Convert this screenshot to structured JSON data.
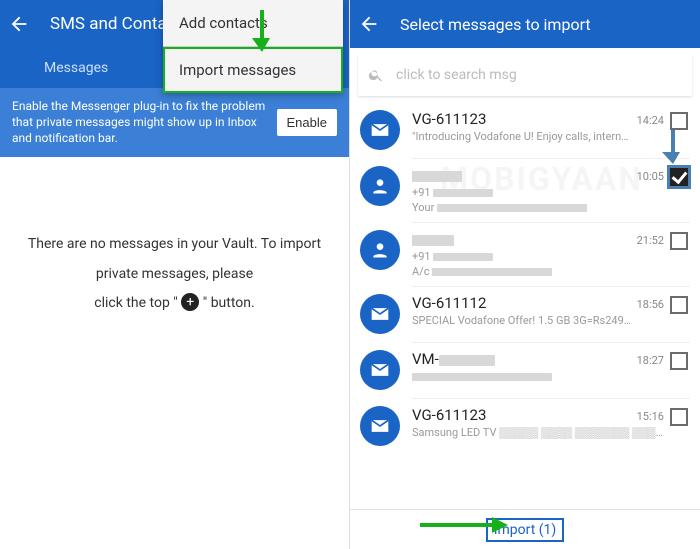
{
  "left": {
    "title": "SMS and Contacts",
    "tab": "Messages",
    "banner": "Enable the Messenger plug-in to fix the problem that private messages might show up in Inbox and notification bar.",
    "enable": "Enable",
    "popup": {
      "add": "Add contacts",
      "import": "Import messages"
    },
    "empty1": "There are no messages in your Vault. To import",
    "empty2": "private messages, please",
    "empty3a": "click the top \" ",
    "empty3b": " \" button."
  },
  "right": {
    "title": "Select messages to import",
    "search_placeholder": "click to search msg",
    "rows": [
      {
        "sender": "VG-611123",
        "time": "14:24",
        "preview": "\"Introducing Vodafone U! Enjoy calls, intern…",
        "icon": "mail",
        "checked": false
      },
      {
        "sender": "",
        "time": "10:05",
        "preview_prefix": "+91",
        "preview2_prefix": "Your",
        "icon": "person",
        "checked": true
      },
      {
        "sender": "",
        "time": "21:52",
        "preview_prefix": "+91",
        "preview2_prefix": "A/c",
        "icon": "person",
        "checked": false
      },
      {
        "sender": "VG-611112",
        "time": "18:56",
        "preview": "SPECIAL Vodafone Offer! 1.5 GB 3G=Rs249…",
        "icon": "mail",
        "checked": false
      },
      {
        "sender": "VM-",
        "time": "18:27",
        "preview": "",
        "icon": "mail",
        "checked": false
      },
      {
        "sender": "VG-611123",
        "time": "15:16",
        "preview": "Samsung LED TV ▒▒▒▒▒ ▒▒▒▒ ▒▒▒▒▒▒▒ ▒▒▒ *567…",
        "icon": "mail",
        "checked": false
      }
    ],
    "import_label": "Import (1)"
  },
  "watermark": "MOBIGYAAN"
}
